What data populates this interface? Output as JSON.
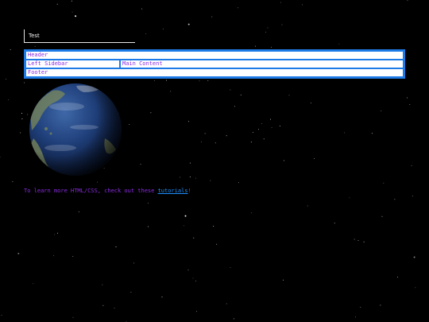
{
  "title": "Test",
  "layout": {
    "header": "Header",
    "left_sidebar": "Left Sidebar",
    "main_content": "Main Content",
    "footer": "Footer"
  },
  "note": {
    "prefix": "To learn more HTML/CSS, check out these ",
    "link_text": "tutorials",
    "suffix": "!"
  },
  "colors": {
    "background": "#000000",
    "layout_border": "#1e7ae6",
    "cell_text": "#8a2be2",
    "link": "#1e90ff"
  }
}
